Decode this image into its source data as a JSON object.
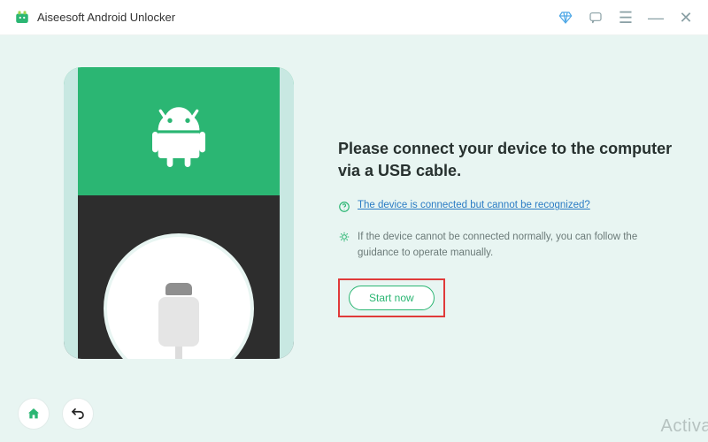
{
  "titlebar": {
    "app_title": "Aiseesoft Android Unlocker"
  },
  "content": {
    "heading": "Please connect your device to the computer via a USB cable.",
    "help_link": "The device is connected but cannot be recognized?",
    "tip_text": "If the device cannot be connected normally, you can follow the guidance to operate manually.",
    "start_btn": "Start now"
  },
  "watermark": "Activa"
}
